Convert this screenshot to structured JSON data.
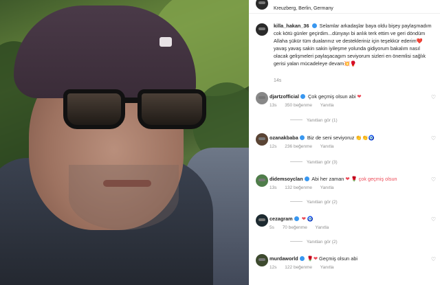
{
  "header": {
    "location": "Kreuzberg, Berlin, Germany"
  },
  "caption": {
    "username": "killa_hakan_36",
    "text": "Selamlar arkadaşlar baya oldu bişey paylaşmadım cok kötü günler geçirdim...dünyayı bi anlık terk ettim ve geri döndüm Allaha şükür tüm dualarınız ve destekleriniz için teşekkür ederim❤️ yavaş yavaş sakin sakin iyileşme yolunda gidiyorum bakalım nasıl olacak gelişmeleri paylaşacagım seviyorum sizleri en önemlisi sağlık gerisi yalan mücadeleye devam💥🥊",
    "time": "14s"
  },
  "comments": [
    {
      "username": "djartzofficial",
      "text": "Çok geçmiş olsun abi",
      "emoji": "❤",
      "time": "13s",
      "likes": "350 beğenme",
      "reply": "Yanıtla",
      "view_replies": "Yanıtları gör (1)"
    },
    {
      "username": "ozanakbaba",
      "text": "Biz de seni seviyoruz",
      "emoji": "👏👏🧿",
      "time": "12s",
      "likes": "236 beğenme",
      "reply": "Yanıtla",
      "view_replies": "Yanıtları gör (3)"
    },
    {
      "username": "didemsoyclan",
      "text": "Abi her zaman",
      "emoji": "❤ 🌹 çok geçmiş olsun",
      "time": "13s",
      "likes": "132 beğenme",
      "reply": "Yanıtla",
      "view_replies": "Yanıtları gör (2)"
    },
    {
      "username": "cezagram",
      "text": "",
      "emoji": "❤ 🧿",
      "time": "5s",
      "likes": "70 beğenme",
      "reply": "Yanıtla",
      "view_replies": "Yanıtları gör (2)"
    },
    {
      "username": "murdaworld",
      "text": "Geçmiş olsun abi",
      "emoji": "🌹❤",
      "time": "12s",
      "likes": "122 beğenme",
      "reply": "Yanıtla",
      "view_replies": ""
    }
  ],
  "colors": {
    "verified": "#3897f0",
    "heart": "#ed4956",
    "muted": "#8e8e8e"
  }
}
